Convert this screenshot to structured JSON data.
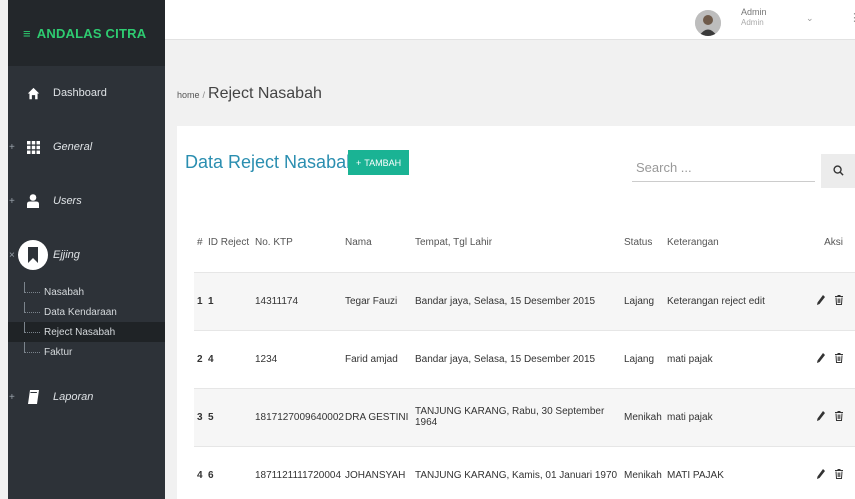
{
  "sidebar": {
    "brand": "ANDALAS CITRA",
    "items": [
      {
        "label": "Dashboard",
        "icon": "home-icon"
      },
      {
        "label": "General",
        "icon": "grid-icon"
      },
      {
        "label": "Users",
        "icon": "user-icon"
      },
      {
        "label": "Ejjing",
        "icon": "bookmark-icon"
      },
      {
        "label": "Laporan",
        "icon": "book-icon"
      }
    ],
    "submenu": [
      "Nasabah",
      "Data Kendaraan",
      "Reject Nasabah",
      "Faktur"
    ]
  },
  "topbar": {
    "user_name": "Admin",
    "user_role": "Admin"
  },
  "breadcrumb": {
    "home": "home",
    "separator": "/",
    "page": "Reject Nasabah"
  },
  "card": {
    "title": "Data Reject Nasabah",
    "add_label": "TAMBAH",
    "search_placeholder": "Search ..."
  },
  "table": {
    "headers": [
      "#",
      "ID Reject",
      "No. KTP",
      "Nama",
      "Tempat, Tgl Lahir",
      "Status",
      "Keterangan",
      "Aksi"
    ],
    "rows": [
      [
        "1",
        "1",
        "14311174",
        "Tegar Fauzi",
        "Bandar jaya, Selasa, 15 Desember 2015",
        "Lajang",
        "Keterangan reject edit"
      ],
      [
        "2",
        "4",
        "1234",
        "Farid amjad",
        "Bandar jaya, Selasa, 15 Desember 2015",
        "Lajang",
        "mati pajak"
      ],
      [
        "3",
        "5",
        "1817127009640002",
        "DRA GESTINI",
        "TANJUNG KARANG, Rabu, 30 September 1964",
        "Menikah",
        "mati pajak"
      ],
      [
        "4",
        "6",
        "1871121111720004",
        "JOHANSYAH",
        "TANJUNG KARANG, Kamis, 01 Januari 1970",
        "Menikah",
        "MATI PAJAK"
      ]
    ]
  },
  "colors": {
    "sidebar_bg": "#2d3238",
    "brand_green": "#2ecc71",
    "title_blue": "#2a8eb0",
    "button_green": "#1ab394"
  }
}
